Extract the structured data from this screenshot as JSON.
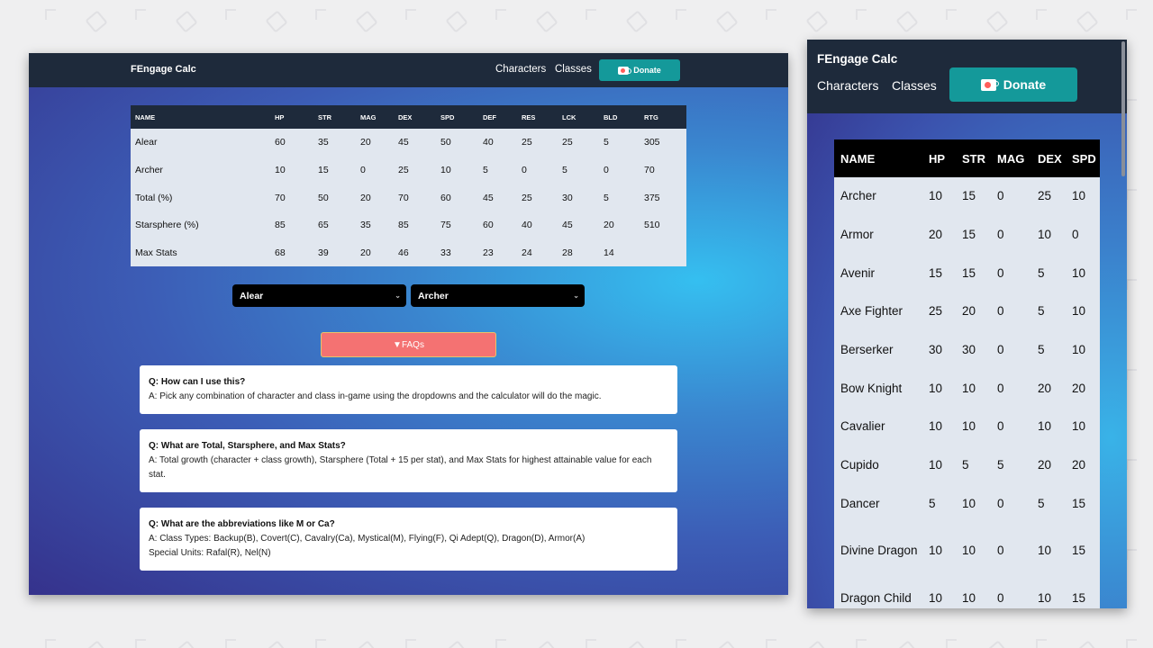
{
  "app": {
    "brand": "FEngage Calc",
    "nav": {
      "characters": "Characters",
      "classes": "Classes",
      "donate": "Donate"
    }
  },
  "colors": {
    "navbar": "#1e2a3b",
    "donate": "#14999a",
    "faq_button": "#f47272",
    "table_row": "#e1e7ef"
  },
  "desktop": {
    "table": {
      "headers": [
        "NAME",
        "HP",
        "STR",
        "MAG",
        "DEX",
        "SPD",
        "DEF",
        "RES",
        "LCK",
        "BLD",
        "RTG"
      ],
      "rows": [
        [
          "Alear",
          "60",
          "35",
          "20",
          "45",
          "50",
          "40",
          "25",
          "25",
          "5",
          "305"
        ],
        [
          "Archer",
          "10",
          "15",
          "0",
          "25",
          "10",
          "5",
          "0",
          "5",
          "0",
          "70"
        ],
        [
          "Total (%)",
          "70",
          "50",
          "20",
          "70",
          "60",
          "45",
          "25",
          "30",
          "5",
          "375"
        ],
        [
          "Starsphere (%)",
          "85",
          "65",
          "35",
          "85",
          "75",
          "60",
          "40",
          "45",
          "20",
          "510"
        ],
        [
          "Max Stats",
          "68",
          "39",
          "20",
          "46",
          "33",
          "23",
          "24",
          "28",
          "14",
          ""
        ]
      ]
    },
    "character_select": "Alear",
    "class_select": "Archer",
    "faq_button": "▼FAQs",
    "faqs": [
      {
        "q": "Q: How can I use this?",
        "a": "A: Pick any combination of character and class in-game using the dropdowns and the calculator will do the magic."
      },
      {
        "q": "Q: What are Total, Starsphere, and Max Stats?",
        "a": "A: Total growth (character + class growth), Starsphere (Total + 15 per stat), and Max Stats for highest attainable value for each stat."
      },
      {
        "q": "Q: What are the abbreviations like M or Ca?",
        "a": "A: Class Types: Backup(B), Covert(C), Cavalry(Ca), Mystical(M), Flying(F), Qi Adept(Q), Dragon(D), Armor(A)",
        "a2": "Special Units: Rafal(R), Nel(N)"
      }
    ]
  },
  "mobile": {
    "table": {
      "headers": [
        "NAME",
        "HP",
        "STR",
        "MAG",
        "DEX",
        "SPD"
      ],
      "rows": [
        [
          "Archer",
          "10",
          "15",
          "0",
          "25",
          "10"
        ],
        [
          "Armor",
          "20",
          "15",
          "0",
          "10",
          "0"
        ],
        [
          "Avenir",
          "15",
          "15",
          "0",
          "5",
          "10"
        ],
        [
          "Axe Fighter",
          "25",
          "20",
          "0",
          "5",
          "10"
        ],
        [
          "Berserker",
          "30",
          "30",
          "0",
          "5",
          "10"
        ],
        [
          "Bow Knight",
          "10",
          "10",
          "0",
          "20",
          "20"
        ],
        [
          "Cavalier",
          "10",
          "10",
          "0",
          "10",
          "10"
        ],
        [
          "Cupido",
          "10",
          "5",
          "5",
          "20",
          "20"
        ],
        [
          "Dancer",
          "5",
          "10",
          "0",
          "5",
          "15"
        ],
        [
          "Divine Dragon",
          "10",
          "10",
          "0",
          "10",
          "15"
        ],
        [
          "Dragon Child",
          "10",
          "10",
          "0",
          "10",
          "15"
        ]
      ]
    }
  }
}
